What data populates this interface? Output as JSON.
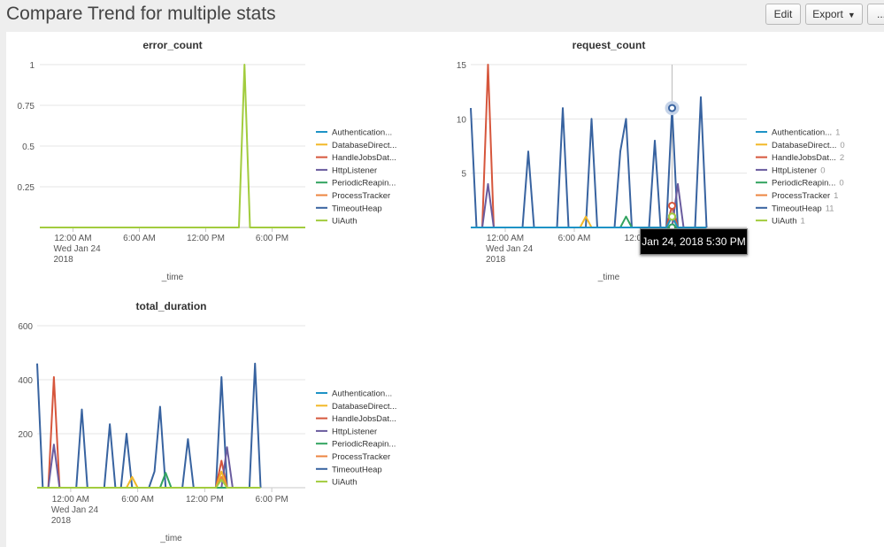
{
  "page": {
    "title": "Compare Trend for multiple stats"
  },
  "toolbar": {
    "edit_label": "Edit",
    "export_label": "Export",
    "more_label": "..."
  },
  "colors": {
    "Authentication...": "#1e93c6",
    "DatabaseDirect...": "#f2b827",
    "HandleJobsDat...": "#d6563c",
    "HttpListener": "#6a5c9e",
    "PeriodicReapin...": "#31a35f",
    "ProcessTracker": "#ed8440",
    "TimeoutHeap": "#3863a0",
    "UiAuth": "#a2cc3e"
  },
  "tooltip": {
    "text": "Jan 24, 2018 5:30 PM"
  },
  "chart_data": [
    {
      "type": "line",
      "title": "error_count",
      "xlabel": "_time",
      "ylabel": "",
      "yticks": [
        "1",
        "0.75",
        "0.5",
        "0.25"
      ],
      "ylim": [
        0,
        1
      ],
      "xticks": [
        {
          "x": 3,
          "lines": [
            "12:00 AM",
            "Wed Jan 24",
            "2018"
          ]
        },
        {
          "x": 9,
          "lines": [
            "6:00 AM"
          ]
        },
        {
          "x": 15,
          "lines": [
            "12:00 PM"
          ]
        },
        {
          "x": 21,
          "lines": [
            "6:00 PM"
          ]
        }
      ],
      "legend": {
        "position": "right",
        "labels": [
          "Authentication...",
          "DatabaseDirect...",
          "HandleJobsDat...",
          "HttpListener",
          "PeriodicReapin...",
          "ProcessTracker",
          "TimeoutHeap",
          "UiAuth"
        ],
        "values": []
      },
      "series": [
        {
          "name": "UiAuth",
          "points": [
            [
              0,
              0
            ],
            [
              18,
              0
            ],
            [
              18.5,
              1
            ],
            [
              19,
              0
            ],
            [
              24,
              0
            ]
          ]
        }
      ],
      "xlim": [
        0,
        24
      ]
    },
    {
      "type": "line",
      "title": "request_count",
      "xlabel": "_time",
      "ylabel": "",
      "yticks": [
        "15",
        "10",
        "5"
      ],
      "ylim": [
        0,
        15
      ],
      "xticks": [
        {
          "x": 3,
          "lines": [
            "12:00 AM",
            "Wed Jan 24",
            "2018"
          ]
        },
        {
          "x": 9,
          "lines": [
            "6:00 AM"
          ]
        },
        {
          "x": 15,
          "lines": [
            "12:00 PM"
          ]
        }
      ],
      "legend": {
        "position": "right",
        "labels": [
          "Authentication...",
          "DatabaseDirect...",
          "HandleJobsDat...",
          "HttpListener",
          "PeriodicReapin...",
          "ProcessTracker",
          "TimeoutHeap",
          "UiAuth"
        ],
        "values": [
          "1",
          "0",
          "2",
          "0",
          "0",
          "1",
          "11",
          "1"
        ]
      },
      "highlight_x": 17.5,
      "highlight_values": [
        1,
        0,
        2,
        0,
        0,
        1,
        11,
        1
      ],
      "series": [
        {
          "name": "TimeoutHeap",
          "points": [
            [
              0,
              11
            ],
            [
              0.5,
              0
            ],
            [
              4.5,
              0
            ],
            [
              5,
              7
            ],
            [
              5.5,
              0
            ],
            [
              7.5,
              0
            ],
            [
              8,
              11
            ],
            [
              8.5,
              0
            ],
            [
              10,
              0
            ],
            [
              10.5,
              10
            ],
            [
              11,
              0
            ],
            [
              12.5,
              0
            ],
            [
              13,
              7
            ],
            [
              13.5,
              10
            ],
            [
              14,
              0
            ],
            [
              15.5,
              0
            ],
            [
              16,
              8
            ],
            [
              16.5,
              0
            ],
            [
              17,
              0
            ],
            [
              17.5,
              11
            ],
            [
              18,
              0
            ],
            [
              19.5,
              0
            ],
            [
              20,
              12
            ],
            [
              20.5,
              0
            ]
          ]
        },
        {
          "name": "HandleJobsDat...",
          "points": [
            [
              0,
              0
            ],
            [
              1,
              0
            ],
            [
              1.5,
              15
            ],
            [
              2,
              0
            ],
            [
              17,
              0
            ],
            [
              17.5,
              2
            ],
            [
              18,
              0
            ],
            [
              20.5,
              0
            ]
          ]
        },
        {
          "name": "HttpListener",
          "points": [
            [
              0,
              0
            ],
            [
              1,
              0
            ],
            [
              1.5,
              4
            ],
            [
              2,
              0
            ],
            [
              17.5,
              0
            ],
            [
              18,
              4
            ],
            [
              18.5,
              0
            ],
            [
              20.5,
              0
            ]
          ]
        },
        {
          "name": "DatabaseDirect...",
          "points": [
            [
              0,
              0
            ],
            [
              9.5,
              0
            ],
            [
              10,
              1
            ],
            [
              10.5,
              0
            ],
            [
              20.5,
              0
            ]
          ]
        },
        {
          "name": "PeriodicReapin...",
          "points": [
            [
              0,
              0
            ],
            [
              13,
              0
            ],
            [
              13.5,
              1
            ],
            [
              14,
              0
            ],
            [
              20.5,
              0
            ]
          ]
        },
        {
          "name": "ProcessTracker",
          "points": [
            [
              0,
              0
            ],
            [
              17,
              0
            ],
            [
              17.5,
              1
            ],
            [
              18,
              0
            ],
            [
              20.5,
              0
            ]
          ]
        },
        {
          "name": "UiAuth",
          "points": [
            [
              0,
              0
            ],
            [
              17,
              0
            ],
            [
              17.5,
              1
            ],
            [
              18,
              0
            ],
            [
              20.5,
              0
            ]
          ]
        },
        {
          "name": "Authentication...",
          "points": [
            [
              0,
              0
            ],
            [
              17,
              0
            ],
            [
              17.5,
              1
            ],
            [
              18,
              0
            ],
            [
              20.5,
              0
            ]
          ]
        }
      ],
      "xlim": [
        0,
        24
      ]
    },
    {
      "type": "line",
      "title": "total_duration",
      "xlabel": "_time",
      "ylabel": "",
      "yticks": [
        "600",
        "400",
        "200"
      ],
      "ylim": [
        0,
        600
      ],
      "xticks": [
        {
          "x": 3,
          "lines": [
            "12:00 AM",
            "Wed Jan 24",
            "2018"
          ]
        },
        {
          "x": 9,
          "lines": [
            "6:00 AM"
          ]
        },
        {
          "x": 15,
          "lines": [
            "12:00 PM"
          ]
        },
        {
          "x": 21,
          "lines": [
            "6:00 PM"
          ]
        }
      ],
      "legend": {
        "position": "right",
        "labels": [
          "Authentication...",
          "DatabaseDirect...",
          "HandleJobsDat...",
          "HttpListener",
          "PeriodicReapin...",
          "ProcessTracker",
          "TimeoutHeap",
          "UiAuth"
        ],
        "values": []
      },
      "series": [
        {
          "name": "TimeoutHeap",
          "points": [
            [
              0,
              460
            ],
            [
              0.5,
              0
            ],
            [
              3.5,
              0
            ],
            [
              4,
              290
            ],
            [
              4.5,
              0
            ],
            [
              6,
              0
            ],
            [
              6.5,
              235
            ],
            [
              7,
              0
            ],
            [
              7.5,
              0
            ],
            [
              8,
              200
            ],
            [
              8.5,
              0
            ],
            [
              10,
              0
            ],
            [
              10.5,
              60
            ],
            [
              11,
              300
            ],
            [
              11.5,
              0
            ],
            [
              13,
              0
            ],
            [
              13.5,
              180
            ],
            [
              14,
              0
            ],
            [
              16,
              0
            ],
            [
              16.5,
              410
            ],
            [
              17,
              0
            ],
            [
              19,
              0
            ],
            [
              19.5,
              460
            ],
            [
              20,
              0
            ]
          ]
        },
        {
          "name": "HandleJobsDat...",
          "points": [
            [
              0,
              0
            ],
            [
              1,
              0
            ],
            [
              1.5,
              410
            ],
            [
              2,
              0
            ],
            [
              16,
              0
            ],
            [
              16.5,
              100
            ],
            [
              17,
              0
            ],
            [
              20,
              0
            ]
          ]
        },
        {
          "name": "HttpListener",
          "points": [
            [
              0,
              0
            ],
            [
              1,
              0
            ],
            [
              1.5,
              160
            ],
            [
              2,
              0
            ],
            [
              16.5,
              0
            ],
            [
              17,
              150
            ],
            [
              17.5,
              0
            ],
            [
              20,
              0
            ]
          ]
        },
        {
          "name": "DatabaseDirect...",
          "points": [
            [
              0,
              0
            ],
            [
              8,
              0
            ],
            [
              8.5,
              40
            ],
            [
              9,
              0
            ],
            [
              16,
              0
            ],
            [
              16.5,
              60
            ],
            [
              17,
              0
            ],
            [
              20,
              0
            ]
          ]
        },
        {
          "name": "PeriodicReapin...",
          "points": [
            [
              0,
              0
            ],
            [
              11,
              0
            ],
            [
              11.5,
              55
            ],
            [
              12,
              0
            ],
            [
              20,
              0
            ]
          ]
        },
        {
          "name": "ProcessTracker",
          "points": [
            [
              0,
              0
            ],
            [
              16,
              0
            ],
            [
              16.5,
              40
            ],
            [
              17,
              0
            ],
            [
              20,
              0
            ]
          ]
        },
        {
          "name": "UiAuth",
          "points": [
            [
              0,
              0
            ],
            [
              16,
              0
            ],
            [
              16.5,
              30
            ],
            [
              17,
              0
            ],
            [
              20,
              0
            ]
          ]
        }
      ],
      "xlim": [
        0,
        24
      ]
    }
  ]
}
